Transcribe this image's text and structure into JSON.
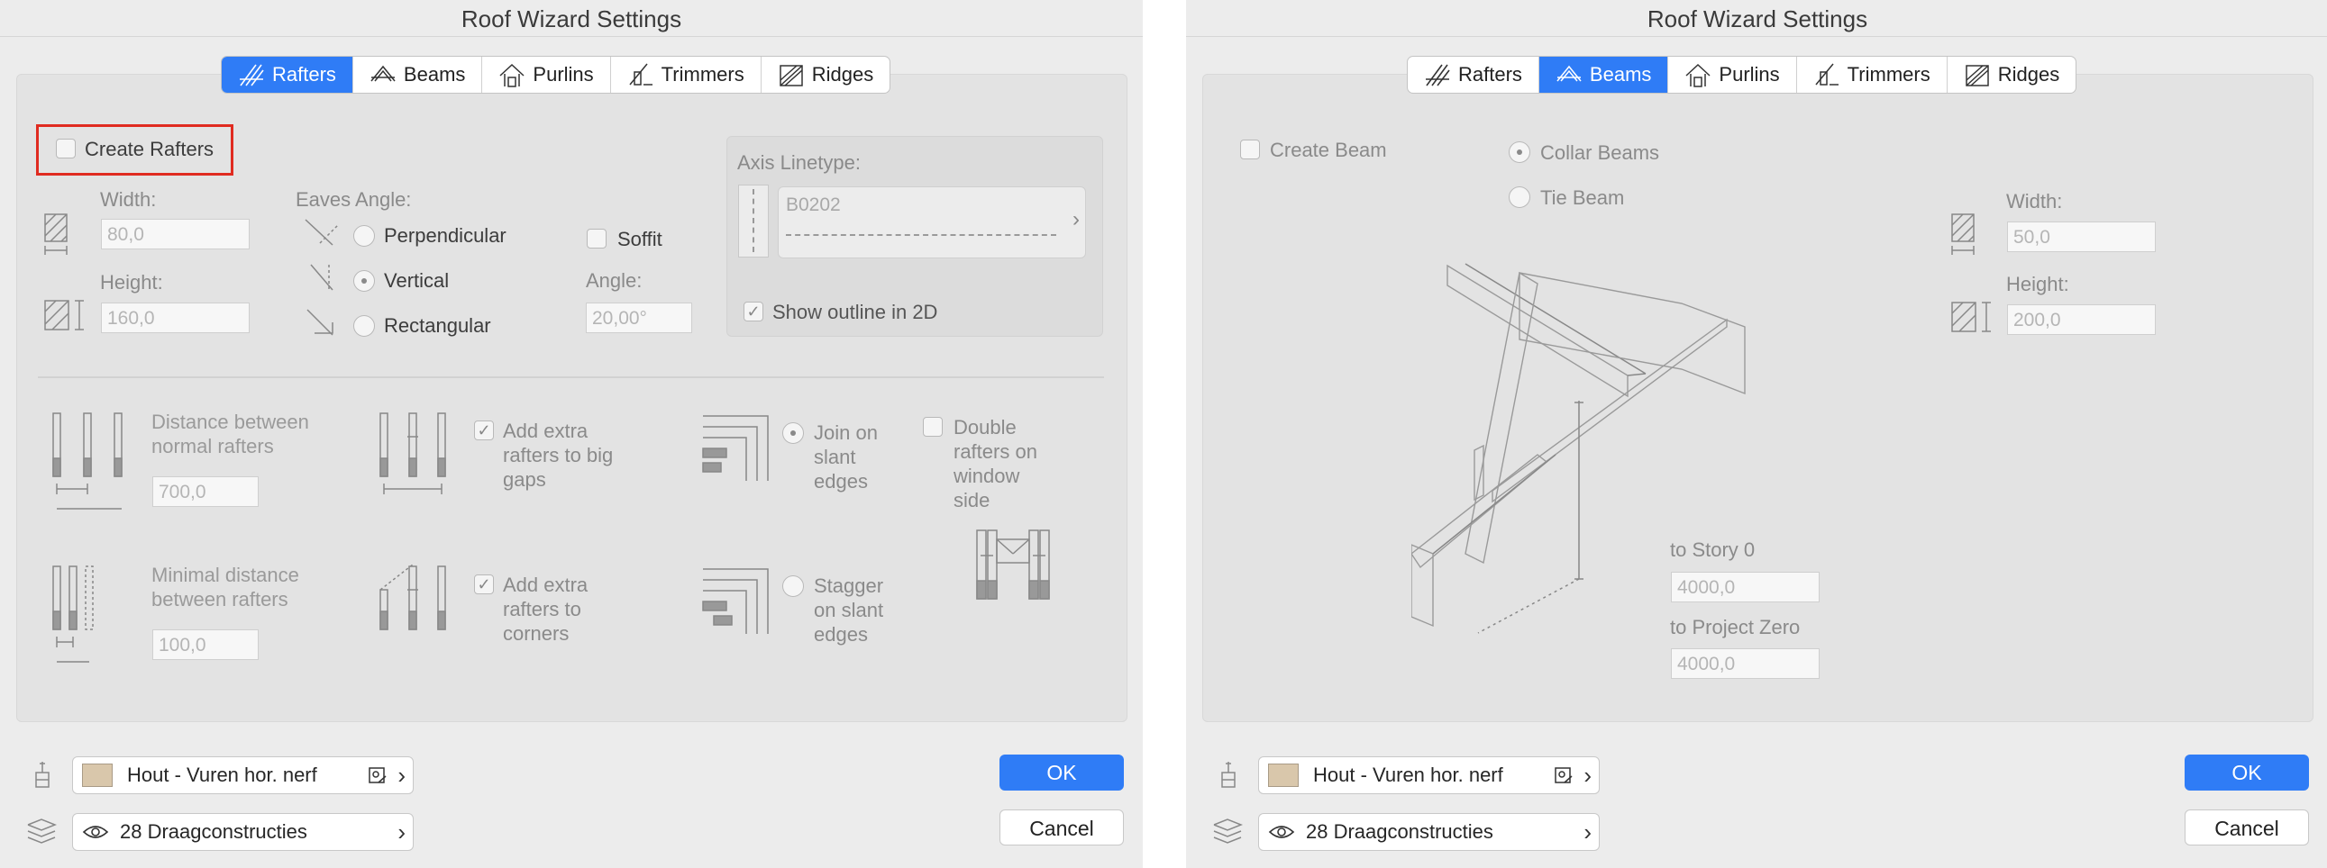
{
  "left": {
    "title": "Roof Wizard Settings",
    "tabs": [
      {
        "label": "Rafters",
        "icon": "rafters-icon",
        "active": true
      },
      {
        "label": "Beams",
        "icon": "beams-icon",
        "active": false
      },
      {
        "label": "Purlins",
        "icon": "purlins-icon",
        "active": false
      },
      {
        "label": "Trimmers",
        "icon": "trimmers-icon",
        "active": false
      },
      {
        "label": "Ridges",
        "icon": "ridges-icon",
        "active": false
      }
    ],
    "create_rafters": {
      "label": "Create Rafters",
      "checked": false
    },
    "width": {
      "label": "Width:",
      "value": "80,0"
    },
    "height": {
      "label": "Height:",
      "value": "160,0"
    },
    "eaves": {
      "label": "Eaves Angle:",
      "perpendicular": "Perpendicular",
      "vertical": "Vertical",
      "rectangular": "Rectangular",
      "selected": "Vertical"
    },
    "soffit": {
      "label": "Soffit",
      "checked": false
    },
    "angle": {
      "label": "Angle:",
      "value": "20,00°"
    },
    "axis_linetype": {
      "label": "Axis Linetype:",
      "value": "B0202"
    },
    "show_outline": {
      "label": "Show outline in 2D",
      "checked": true
    },
    "distance_normal": {
      "label_line1": "Distance between",
      "label_line2": "normal rafters",
      "value": "700,0"
    },
    "minimal_distance": {
      "label_line1": "Minimal distance",
      "label_line2": "between rafters",
      "value": "100,0"
    },
    "add_extra_big_gaps": {
      "line1": "Add extra",
      "line2": "rafters to big",
      "line3": "gaps",
      "checked": true
    },
    "add_extra_corners": {
      "line1": "Add extra",
      "line2": "rafters to",
      "line3": "corners",
      "checked": true
    },
    "join_slant": {
      "line1": "Join on",
      "line2": "slant",
      "line3": "edges",
      "selected": true
    },
    "stagger_slant": {
      "line1": "Stagger",
      "line2": "on slant",
      "line3": "edges",
      "selected": false
    },
    "double_rafters": {
      "line1": "Double",
      "line2": "rafters on",
      "line3": "window",
      "line4": "side",
      "checked": false
    },
    "material": "Hout - Vuren hor. nerf",
    "layer": "28 Draagconstructies",
    "ok": "OK",
    "cancel": "Cancel"
  },
  "right": {
    "title": "Roof Wizard Settings",
    "tabs": [
      {
        "label": "Rafters",
        "icon": "rafters-icon",
        "active": false
      },
      {
        "label": "Beams",
        "icon": "beams-icon",
        "active": true
      },
      {
        "label": "Purlins",
        "icon": "purlins-icon",
        "active": false
      },
      {
        "label": "Trimmers",
        "icon": "trimmers-icon",
        "active": false
      },
      {
        "label": "Ridges",
        "icon": "ridges-icon",
        "active": false
      }
    ],
    "create_beam": {
      "label": "Create Beam",
      "checked": false
    },
    "collar_beams": {
      "label": "Collar Beams",
      "selected": true
    },
    "tie_beam": {
      "label": "Tie Beam",
      "selected": false
    },
    "width": {
      "label": "Width:",
      "value": "50,0"
    },
    "height": {
      "label": "Height:",
      "value": "200,0"
    },
    "to_story": {
      "label": "to Story 0",
      "value": "4000,0"
    },
    "to_project_zero": {
      "label": "to Project Zero",
      "value": "4000,0"
    },
    "material": "Hout - Vuren hor. nerf",
    "layer": "28 Draagconstructies",
    "ok": "OK",
    "cancel": "Cancel"
  },
  "colors": {
    "accent": "#2f7cf6",
    "highlight": "#e02b20",
    "swatch": "#d9c7ab"
  }
}
